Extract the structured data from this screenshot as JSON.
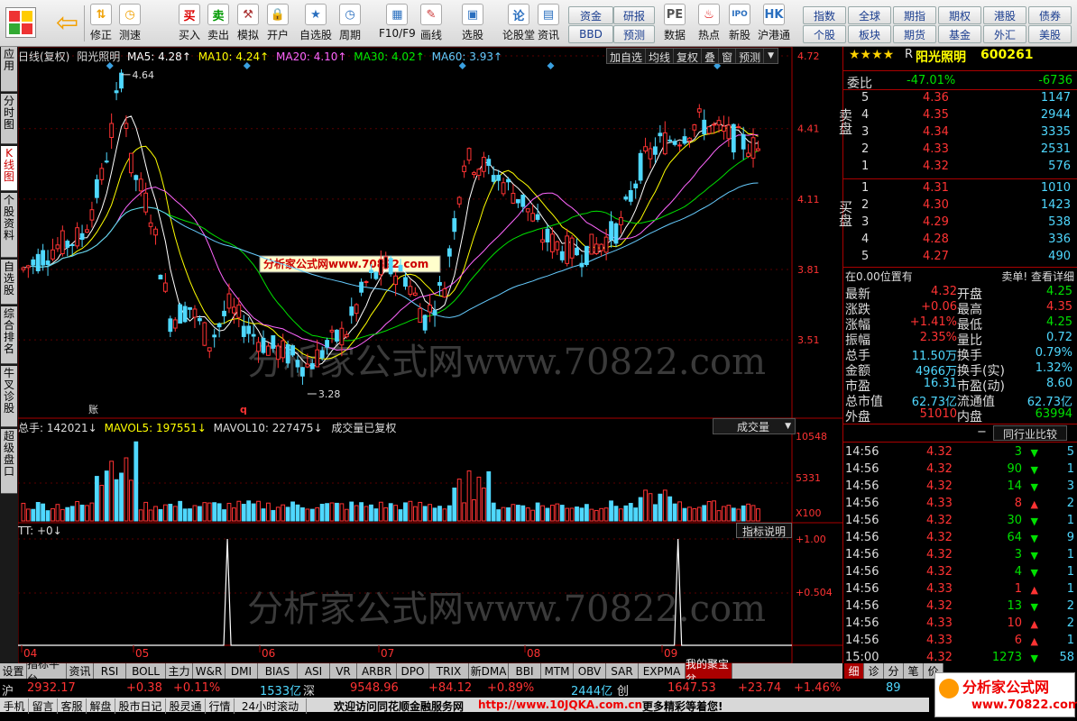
{
  "toolbar": {
    "buttons": [
      {
        "label": "修正",
        "icon": "up-down-arrow-icon"
      },
      {
        "label": "测速",
        "icon": "clock-icon"
      },
      {
        "label": "买入",
        "icon": "buy-icon"
      },
      {
        "label": "卖出",
        "icon": "sell-icon"
      },
      {
        "label": "模拟",
        "icon": "hammer-icon"
      },
      {
        "label": "开户",
        "icon": "lock-icon"
      },
      {
        "label": "自选股",
        "icon": "star-icon"
      },
      {
        "label": "周期",
        "icon": "clock-icon"
      },
      {
        "label": "F10/F9",
        "icon": "f10-icon"
      },
      {
        "label": "画线",
        "icon": "pencil-icon"
      },
      {
        "label": "选股",
        "icon": "screen-icon"
      },
      {
        "label": "论股堂",
        "icon": "lun-icon"
      },
      {
        "label": "资讯",
        "icon": "document-icon"
      },
      {
        "label": "数据",
        "icon": "pe-icon"
      },
      {
        "label": "热点",
        "icon": "hot-icon"
      },
      {
        "label": "新股",
        "icon": "ipo-icon"
      },
      {
        "label": "沪港通",
        "icon": "hk-icon"
      }
    ],
    "quick_buttons": [
      "资金",
      "研报",
      "BBD",
      "预测"
    ],
    "market_buttons": [
      "指数",
      "全球",
      "期指",
      "期权",
      "港股",
      "债券",
      "个股",
      "板块",
      "期货",
      "基金",
      "外汇",
      "美股"
    ]
  },
  "left_tabs": [
    "应用",
    "分时图",
    "K线图",
    "个股资料",
    "自选股",
    "综合排名",
    "牛叉诊股",
    "超级盘口"
  ],
  "chart": {
    "header": {
      "period": "日线(复权)",
      "name": "阳光照明",
      "ma5": "MA5: 4.28↑",
      "ma10": "MA10: 4.24↑",
      "ma20": "MA20: 4.10↑",
      "ma30": "MA30: 4.02↑",
      "ma60": "MA60: 3.93↑"
    },
    "header_buttons": [
      "加自选",
      "均线",
      "复权",
      "叠",
      "窗",
      "预测"
    ],
    "price_axis": [
      "4.72",
      "4.41",
      "4.11",
      "3.81",
      "3.51"
    ],
    "high_label": "4.64",
    "low_label": "3.28",
    "watermark_small": "分析家公式网www.70822.com",
    "watermark_big": "分析家公式网www.70822.com",
    "volume_header": {
      "total": "总手: 142021↓",
      "mavol5": "MAVOL5: 197551↓",
      "mavol10": "MAVOL10: 227475↓",
      "note": "成交量已复权"
    },
    "volume_dropdown": "成交量",
    "volume_axis": [
      "10548",
      "5331",
      "X100"
    ],
    "tt_header": "TT: +0↓",
    "tt_button": "指标说明",
    "tt_axis": [
      "+1.00",
      "+0.504"
    ],
    "months": [
      "04",
      "05",
      "06",
      "07",
      "08",
      "09"
    ],
    "markers": [
      "账",
      "q"
    ]
  },
  "quote": {
    "stars": "★★★★",
    "r_badge": "R",
    "name": "阳光照明",
    "code": "600261",
    "weibi_label": "委比",
    "weibi": "-47.01%",
    "weicha": "-6736",
    "sell_label": "卖盘",
    "buy_label": "买盘",
    "asks": [
      {
        "level": "5",
        "price": "4.36",
        "vol": "1147"
      },
      {
        "level": "4",
        "price": "4.35",
        "vol": "2944"
      },
      {
        "level": "3",
        "price": "4.34",
        "vol": "3335"
      },
      {
        "level": "2",
        "price": "4.33",
        "vol": "2531"
      },
      {
        "level": "1",
        "price": "4.32",
        "vol": "576"
      }
    ],
    "bids": [
      {
        "level": "1",
        "price": "4.31",
        "vol": "1010"
      },
      {
        "level": "2",
        "price": "4.30",
        "vol": "1423"
      },
      {
        "level": "3",
        "price": "4.29",
        "vol": "538"
      },
      {
        "level": "4",
        "price": "4.28",
        "vol": "336"
      },
      {
        "level": "5",
        "price": "4.27",
        "vol": "490"
      }
    ],
    "position_text": "在0.00位置有",
    "detail_text": "卖单! 查看详细",
    "stats": [
      {
        "l1": "最新",
        "v1": "4.32",
        "l2": "开盘",
        "v2": "4.25"
      },
      {
        "l1": "涨跌",
        "v1": "+0.06",
        "l2": "最高",
        "v2": "4.35"
      },
      {
        "l1": "涨幅",
        "v1": "+1.41%",
        "l2": "最低",
        "v2": "4.25"
      },
      {
        "l1": "振幅",
        "v1": "2.35%",
        "l2": "量比",
        "v2": "0.72"
      },
      {
        "l1": "总手",
        "v1": "11.50万",
        "l2": "换手",
        "v2": "0.79%"
      },
      {
        "l1": "金额",
        "v1": "4966万",
        "l2": "换手(实)",
        "v2": "1.32%"
      },
      {
        "l1": "市盈",
        "v1": "16.31",
        "l2": "市盈(动)",
        "v2": "8.60"
      },
      {
        "l1": "总市值",
        "v1": "62.73亿",
        "l2": "流通值",
        "v2": "62.73亿"
      },
      {
        "l1": "外盘",
        "v1": "51010",
        "l2": "内盘",
        "v2": "63994"
      }
    ],
    "compare_button": "同行业比较",
    "ticks": [
      {
        "t": "14:56",
        "p": "4.32",
        "v": "3",
        "d": "down",
        "n": "5"
      },
      {
        "t": "14:56",
        "p": "4.32",
        "v": "90",
        "d": "down",
        "n": "1"
      },
      {
        "t": "14:56",
        "p": "4.32",
        "v": "14",
        "d": "down",
        "n": "3"
      },
      {
        "t": "14:56",
        "p": "4.33",
        "v": "8",
        "d": "up",
        "n": "2"
      },
      {
        "t": "14:56",
        "p": "4.32",
        "v": "30",
        "d": "down",
        "n": "1"
      },
      {
        "t": "14:56",
        "p": "4.32",
        "v": "64",
        "d": "down",
        "n": "9"
      },
      {
        "t": "14:56",
        "p": "4.32",
        "v": "3",
        "d": "down",
        "n": "1"
      },
      {
        "t": "14:56",
        "p": "4.32",
        "v": "4",
        "d": "down",
        "n": "1"
      },
      {
        "t": "14:56",
        "p": "4.33",
        "v": "1",
        "d": "up",
        "n": "1"
      },
      {
        "t": "14:56",
        "p": "4.32",
        "v": "13",
        "d": "down",
        "n": "2"
      },
      {
        "t": "14:56",
        "p": "4.33",
        "v": "10",
        "d": "up",
        "n": "2"
      },
      {
        "t": "14:56",
        "p": "4.33",
        "v": "6",
        "d": "up",
        "n": "1"
      },
      {
        "t": "15:00",
        "p": "4.32",
        "v": "1273",
        "d": "down",
        "n": "58"
      }
    ],
    "detail_tabs": [
      "细",
      "诊",
      "分",
      "笔",
      "价"
    ]
  },
  "bottom_tabs": [
    "设置",
    "指标平台",
    "资讯",
    "RSI",
    "BOLL",
    "主力",
    "W&R",
    "DMI",
    "BIAS",
    "ASI",
    "VR",
    "ARBR",
    "DPO",
    "TRIX",
    "新DMA",
    "BBI",
    "MTM",
    "OBV",
    "SAR",
    "EXPMA",
    "我的聚宝盆"
  ],
  "index_bar": {
    "sh_label": "沪",
    "sh_val": "2932.17",
    "sh_chg": "+0.38",
    "sh_pct": "+0.11%",
    "sh_amt": "1533亿",
    "sz_label": "深",
    "sz_val": "9548.96",
    "sz_chg": "+84.12",
    "sz_pct": "+0.89%",
    "sz_amt": "2444亿",
    "cy_label": "创",
    "cy_val": "1647.53",
    "cy_chg": "+23.74",
    "cy_pct": "+1.46%",
    "extra": "89"
  },
  "status_bar": {
    "items": [
      "手机",
      "留言",
      "客服",
      "解盘",
      "股市日记",
      "股灵通",
      "行情",
      "24小时滚动"
    ],
    "welcome": "欢迎访问同花顺金融服务网",
    "url": "http://www.10JQKA.com.cn",
    "more": "更多精彩等着您!"
  },
  "logo_text": "分析家公式网",
  "logo_url": "www.70822.com",
  "colors": {
    "up": "#ff3333",
    "down": "#4fd8ff",
    "ma5": "#ffffff",
    "ma10": "#ffff00",
    "ma20": "#ff66ff",
    "ma30": "#00e000",
    "ma60": "#66ccff"
  }
}
